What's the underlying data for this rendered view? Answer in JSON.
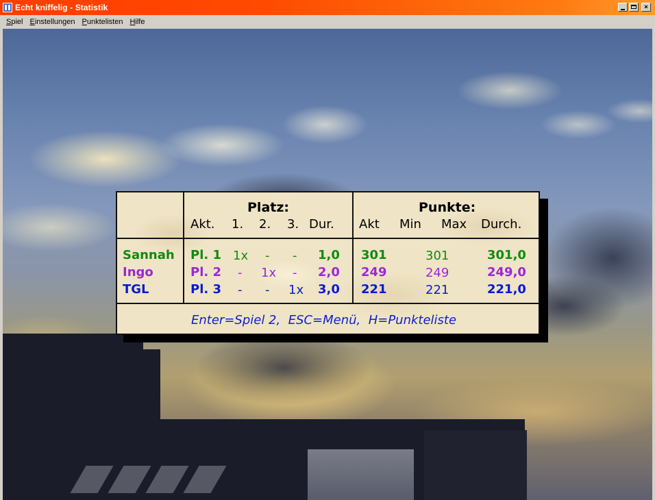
{
  "window": {
    "title": "Echt kniffelig - Statistik",
    "controls": {
      "minimize": "minimize",
      "maximize": "maximize",
      "close": "×"
    }
  },
  "menubar": {
    "items": [
      "Spiel",
      "Einstellungen",
      "Punktelisten",
      "Hilfe"
    ]
  },
  "table": {
    "placement_header": "Platz:",
    "points_header": "Punkte:",
    "placement_columns": [
      "Akt.",
      "1.",
      "2.",
      "3.",
      "Dur."
    ],
    "points_columns": [
      "Akt",
      "Min",
      "Max",
      "Durch."
    ],
    "players": [
      {
        "name": "Sannah",
        "color": "#108a10",
        "akt": "Pl. 1",
        "p1": "1x",
        "p2": "-",
        "p3": "-",
        "dur": "1,0",
        "points_akt": "301",
        "points_min": "301",
        "points_durch": "301,0"
      },
      {
        "name": "Ingo",
        "color": "#9b27d8",
        "akt": "Pl. 2",
        "p1": "-",
        "p2": "1x",
        "p3": "-",
        "dur": "2,0",
        "points_akt": "249",
        "points_min": "249",
        "points_durch": "249,0"
      },
      {
        "name": "TGL",
        "color": "#0a18d8",
        "akt": "Pl. 3",
        "p1": "-",
        "p2": "-",
        "p3": "1x",
        "dur": "3,0",
        "points_akt": "221",
        "points_min": "221",
        "points_durch": "221,0"
      }
    ],
    "footer": "Enter=Spiel 2,  ESC=Menü,  H=Punkteliste"
  }
}
